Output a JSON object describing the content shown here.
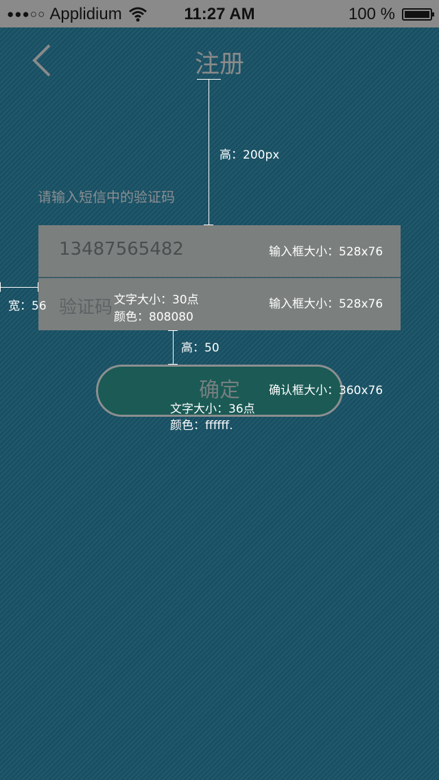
{
  "status_bar": {
    "signal_dots": "●●●○○",
    "carrier": "Applidium",
    "time": "11:27 AM",
    "battery_text": "100 %",
    "battery_level": 1.0
  },
  "nav": {
    "back_icon": "chevron-left-icon",
    "title": "注册"
  },
  "form": {
    "prompt": "请输入短信中的验证码",
    "phone_value": "13487565482",
    "code_placeholder": "验证码",
    "confirm_label": "确定"
  },
  "annotations": {
    "title_gap": "高：200px",
    "phone_box_size": "输入框大小：528x76",
    "code_box_size": "输入框大小：528x76",
    "left_width": "宽：56",
    "text_size": "文字大小：30点",
    "text_color": "颜色：808080",
    "button_gap": "高：50",
    "button_size": "确认框大小：360x76",
    "button_text_size": "文字大小：36点",
    "button_text_color": "颜色：ffffff."
  },
  "colors": {
    "background": "#1a5367",
    "status_bar": "#8a8a8a",
    "input_bg": "#7b807f",
    "button_bg": "#1b5a55",
    "annotation_text": "#ffffff"
  }
}
